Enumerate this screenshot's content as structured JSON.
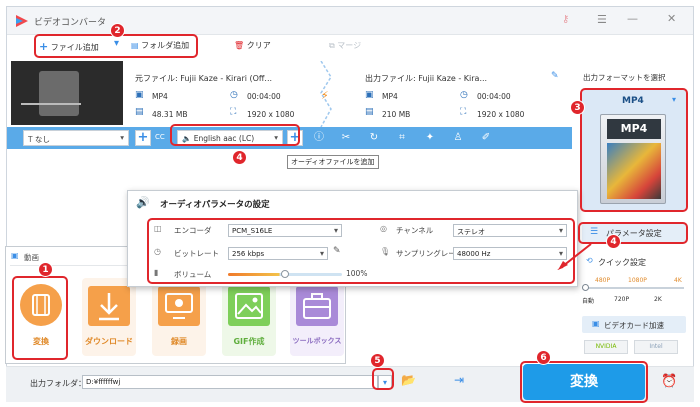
{
  "titlebar": {
    "title": "ビデオコンバータ"
  },
  "toolbar": {
    "add_file": "ファイル追加",
    "add_folder": "フォルダ追加",
    "clear": "クリア",
    "merge": "マージ"
  },
  "file": {
    "source_label": "元ファイル: Fujii Kaze - Kirari (Off...",
    "source_format": "MP4",
    "source_duration": "00:04:00",
    "source_size": "48.31 MB",
    "source_res": "1920 x 1080",
    "output_label": "出力ファイル: Fujii Kaze - Kira...",
    "output_format": "MP4",
    "output_duration": "00:04:00",
    "output_size": "210 MB",
    "output_res": "1920 x 1080"
  },
  "bluebar": {
    "subtitle": "なし",
    "audio_track": "English aac (LC)",
    "tooltip": "オーディオファイルを追加"
  },
  "rightpanel": {
    "select_format": "出力フォーマットを選択",
    "format": "MP4",
    "format_thumb": "MP4",
    "param_settings": "パラメータ設定",
    "quick_settings": "クイック設定",
    "quality_top": [
      "480P",
      "1080P",
      "4K"
    ],
    "quality_bottom": [
      "自動",
      "720P",
      "2K"
    ],
    "gpu_accel": "ビデオカード加速",
    "nvidia": "NVIDIA",
    "intel": "Intel"
  },
  "dialog": {
    "title": "オーディオパラメータの設定",
    "encoder_label": "エンコーダ",
    "encoder_value": "PCM_S16LE",
    "channel_label": "チャンネル",
    "channel_value": "ステレオ",
    "bitrate_label": "ビットレート",
    "bitrate_value": "256 kbps",
    "samplerate_label": "サンプリングレート",
    "samplerate_value": "48000 Hz",
    "volume_label": "ボリューム",
    "volume_value": "100%",
    "volume_level": 0.5
  },
  "tools": {
    "header": "動画",
    "items": [
      "変換",
      "ダウンロード",
      "録画",
      "GIF作成",
      "ツールボックス"
    ]
  },
  "bottom": {
    "output_folder_label": "出力フォルダ：",
    "output_folder_value": "D:¥ffffffwj",
    "convert": "変換"
  },
  "badges": [
    "1",
    "2",
    "3",
    "4",
    "4",
    "5",
    "6"
  ],
  "colors": {
    "accent_blue": "#5aaae8",
    "convert_blue": "#1e9be8",
    "highlight_red": "#e0262c",
    "tool_orange": "#f5a04a",
    "tool_green": "#7ecf5a",
    "tool_purple": "#a98ad8"
  }
}
